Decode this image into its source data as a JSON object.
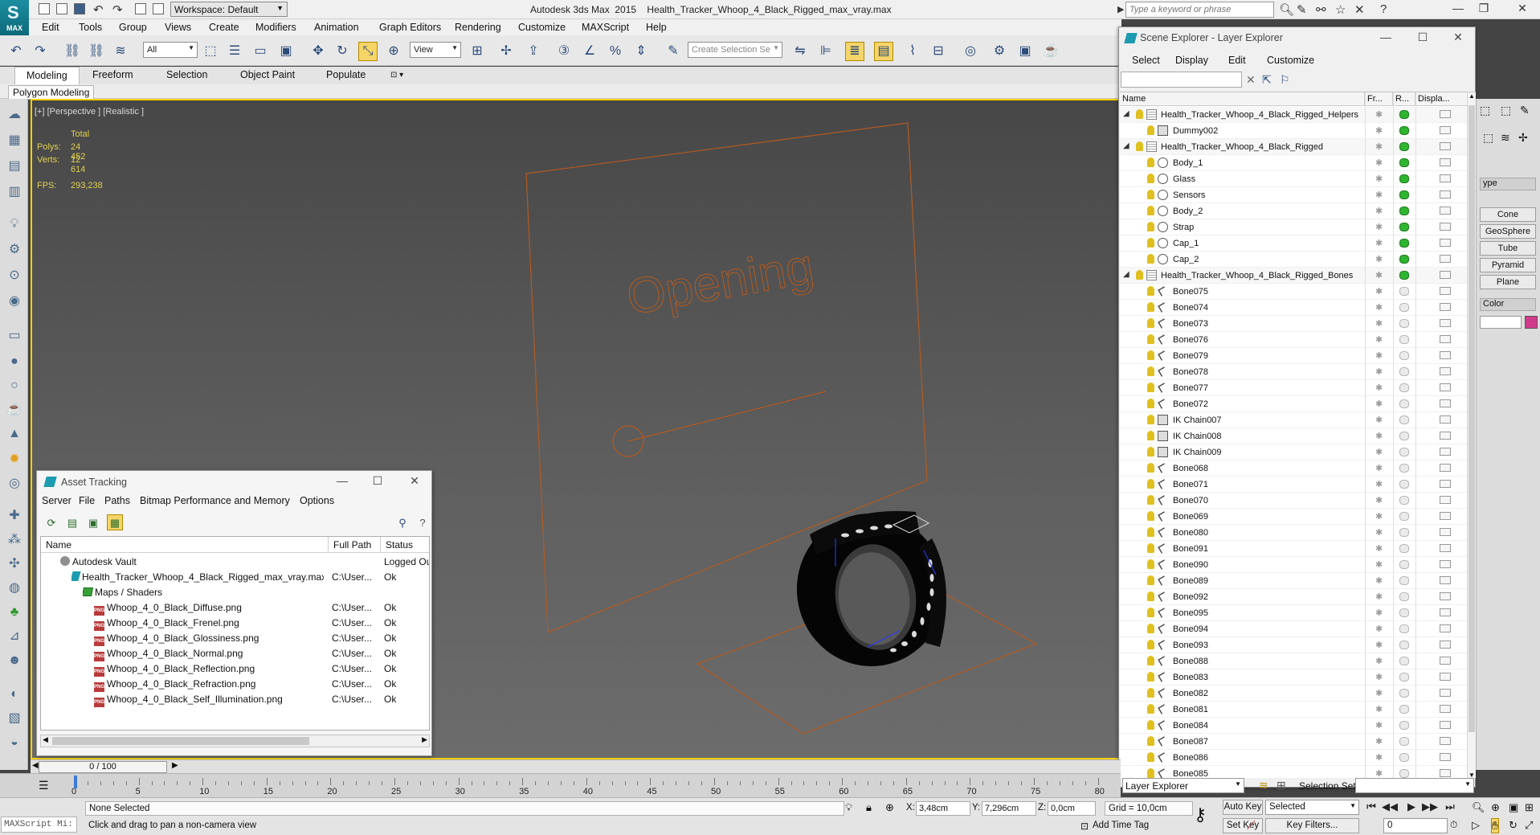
{
  "window": {
    "title": "Autodesk 3ds Max  2015    Health_Tracker_Whoop_4_Black_Rigged_max_vray.max",
    "app_logo": "MAX",
    "workspace": "Workspace: Default",
    "search_placeholder": "Type a keyword or phrase"
  },
  "menubar": [
    "Edit",
    "Tools",
    "Group",
    "Views",
    "Create",
    "Modifiers",
    "Animation",
    "Graph Editors",
    "Rendering",
    "Customize",
    "MAXScript",
    "Help"
  ],
  "toolbar": {
    "selection_filter": "All",
    "ref_coord": "View",
    "named_selection_placeholder": "Create Selection Se"
  },
  "ribbon": {
    "tabs": [
      "Modeling",
      "Freeform",
      "Selection",
      "Object Paint",
      "Populate"
    ],
    "active_tab": "Modeling",
    "panel_label": "Polygon Modeling"
  },
  "viewport": {
    "label": "[+] [Perspective ] [Realistic ]",
    "stats": {
      "header": "Total",
      "polys_label": "Polys:",
      "polys": "24 452",
      "verts_label": "Verts:",
      "verts": "12 614",
      "fps_label": "FPS:",
      "fps": "293,238"
    },
    "scene_text": "Opening"
  },
  "asset_tracking": {
    "title": "Asset Tracking",
    "menu": [
      "Server",
      "File",
      "Paths",
      "Bitmap Performance and Memory",
      "Options"
    ],
    "columns": [
      "Name",
      "Full Path",
      "Status"
    ],
    "rows": [
      {
        "name": "Autodesk Vault",
        "path": "",
        "status": "Logged Ou",
        "icon": "vault-icon"
      },
      {
        "name": "Health_Tracker_Whoop_4_Black_Rigged_max_vray.max",
        "path": "C:\\User...",
        "status": "Ok",
        "icon": "max-file-icon"
      },
      {
        "name": "Maps / Shaders",
        "path": "",
        "status": "",
        "icon": "folder-icon"
      },
      {
        "name": "Whoop_4_0_Black_Diffuse.png",
        "path": "C:\\User...",
        "status": "Ok",
        "icon": "png-file-icon"
      },
      {
        "name": "Whoop_4_0_Black_Frenel.png",
        "path": "C:\\User...",
        "status": "Ok",
        "icon": "png-file-icon"
      },
      {
        "name": "Whoop_4_0_Black_Glossiness.png",
        "path": "C:\\User...",
        "status": "Ok",
        "icon": "png-file-icon"
      },
      {
        "name": "Whoop_4_0_Black_Normal.png",
        "path": "C:\\User...",
        "status": "Ok",
        "icon": "png-file-icon"
      },
      {
        "name": "Whoop_4_0_Black_Reflection.png",
        "path": "C:\\User...",
        "status": "Ok",
        "icon": "png-file-icon"
      },
      {
        "name": "Whoop_4_0_Black_Refraction.png",
        "path": "C:\\User...",
        "status": "Ok",
        "icon": "png-file-icon"
      },
      {
        "name": "Whoop_4_0_Black_Self_Illumination.png",
        "path": "C:\\User...",
        "status": "Ok",
        "icon": "png-file-icon"
      }
    ]
  },
  "scene_explorer": {
    "title": "Scene Explorer - Layer Explorer",
    "menu": [
      "Select",
      "Display",
      "Edit",
      "Customize"
    ],
    "columns": [
      "Name",
      "Fr...",
      "R...",
      "Displa..."
    ],
    "rows": [
      {
        "name": "Health_Tracker_Whoop_4_Black_Rigged_Helpers",
        "level": 0,
        "type": "layer",
        "renderable": true
      },
      {
        "name": "Dummy002",
        "level": 1,
        "type": "helper",
        "renderable": true
      },
      {
        "name": "Health_Tracker_Whoop_4_Black_Rigged",
        "level": 0,
        "type": "layer",
        "renderable": true
      },
      {
        "name": "Body_1",
        "level": 1,
        "type": "geo",
        "renderable": true
      },
      {
        "name": "Glass",
        "level": 1,
        "type": "geo",
        "renderable": true
      },
      {
        "name": "Sensors",
        "level": 1,
        "type": "geo",
        "renderable": true
      },
      {
        "name": "Body_2",
        "level": 1,
        "type": "geo",
        "renderable": true
      },
      {
        "name": "Strap",
        "level": 1,
        "type": "geo",
        "renderable": true
      },
      {
        "name": "Cap_1",
        "level": 1,
        "type": "geo",
        "renderable": true
      },
      {
        "name": "Cap_2",
        "level": 1,
        "type": "geo",
        "renderable": true
      },
      {
        "name": "Health_Tracker_Whoop_4_Black_Rigged_Bones",
        "level": 0,
        "type": "layer",
        "renderable": true
      },
      {
        "name": "Bone075",
        "level": 1,
        "type": "bone",
        "renderable": false
      },
      {
        "name": "Bone074",
        "level": 1,
        "type": "bone",
        "renderable": false
      },
      {
        "name": "Bone073",
        "level": 1,
        "type": "bone",
        "renderable": false
      },
      {
        "name": "Bone076",
        "level": 1,
        "type": "bone",
        "renderable": false
      },
      {
        "name": "Bone079",
        "level": 1,
        "type": "bone",
        "renderable": false
      },
      {
        "name": "Bone078",
        "level": 1,
        "type": "bone",
        "renderable": false
      },
      {
        "name": "Bone077",
        "level": 1,
        "type": "bone",
        "renderable": false
      },
      {
        "name": "Bone072",
        "level": 1,
        "type": "bone",
        "renderable": false
      },
      {
        "name": "IK Chain007",
        "level": 1,
        "type": "helper",
        "renderable": false
      },
      {
        "name": "IK Chain008",
        "level": 1,
        "type": "helper",
        "renderable": false
      },
      {
        "name": "IK Chain009",
        "level": 1,
        "type": "helper",
        "renderable": false
      },
      {
        "name": "Bone068",
        "level": 1,
        "type": "bone",
        "renderable": false
      },
      {
        "name": "Bone071",
        "level": 1,
        "type": "bone",
        "renderable": false
      },
      {
        "name": "Bone070",
        "level": 1,
        "type": "bone",
        "renderable": false
      },
      {
        "name": "Bone069",
        "level": 1,
        "type": "bone",
        "renderable": false
      },
      {
        "name": "Bone080",
        "level": 1,
        "type": "bone",
        "renderable": false
      },
      {
        "name": "Bone091",
        "level": 1,
        "type": "bone",
        "renderable": false
      },
      {
        "name": "Bone090",
        "level": 1,
        "type": "bone",
        "renderable": false
      },
      {
        "name": "Bone089",
        "level": 1,
        "type": "bone",
        "renderable": false
      },
      {
        "name": "Bone092",
        "level": 1,
        "type": "bone",
        "renderable": false
      },
      {
        "name": "Bone095",
        "level": 1,
        "type": "bone",
        "renderable": false
      },
      {
        "name": "Bone094",
        "level": 1,
        "type": "bone",
        "renderable": false
      },
      {
        "name": "Bone093",
        "level": 1,
        "type": "bone",
        "renderable": false
      },
      {
        "name": "Bone088",
        "level": 1,
        "type": "bone",
        "renderable": false
      },
      {
        "name": "Bone083",
        "level": 1,
        "type": "bone",
        "renderable": false
      },
      {
        "name": "Bone082",
        "level": 1,
        "type": "bone",
        "renderable": false
      },
      {
        "name": "Bone081",
        "level": 1,
        "type": "bone",
        "renderable": false
      },
      {
        "name": "Bone084",
        "level": 1,
        "type": "bone",
        "renderable": false
      },
      {
        "name": "Bone087",
        "level": 1,
        "type": "bone",
        "renderable": false
      },
      {
        "name": "Bone086",
        "level": 1,
        "type": "bone",
        "renderable": false
      },
      {
        "name": "Bone085",
        "level": 1,
        "type": "bone",
        "renderable": false
      }
    ],
    "footer": {
      "explorer_type": "Layer Explorer",
      "selection_set_label": "Selection Set:"
    }
  },
  "command_panel": {
    "type_label": "ype",
    "buttons": [
      "Cone",
      "GeoSphere",
      "Tube",
      "Pyramid",
      "Plane"
    ],
    "color_label": "Color",
    "swatch_color": "#d13a8a"
  },
  "timeline": {
    "slider_text": "0 / 100",
    "ticks": [
      "0",
      "5",
      "10",
      "15",
      "20",
      "25",
      "30",
      "35",
      "40",
      "45",
      "50",
      "55",
      "60",
      "65",
      "70",
      "75",
      "80"
    ]
  },
  "statusbar": {
    "maxscript": "MAXScript Mi:",
    "selection": "None Selected",
    "prompt": "Click and drag to pan a non-camera view",
    "x_label": "X:",
    "x_value": "3,48cm",
    "y_label": "Y:",
    "y_value": "7,296cm",
    "z_label": "Z:",
    "z_value": "0,0cm",
    "grid": "Grid = 10,0cm",
    "add_time_tag": "Add Time Tag",
    "auto_key": "Auto Key",
    "set_key": "Set Key",
    "auto_key_mode": "Selected",
    "key_filters": "Key Filters...",
    "frame": "0"
  },
  "colors": {
    "viewport_border": "#f5d100",
    "scene_lines": "#b45a20",
    "active_button": "#f5d567"
  }
}
